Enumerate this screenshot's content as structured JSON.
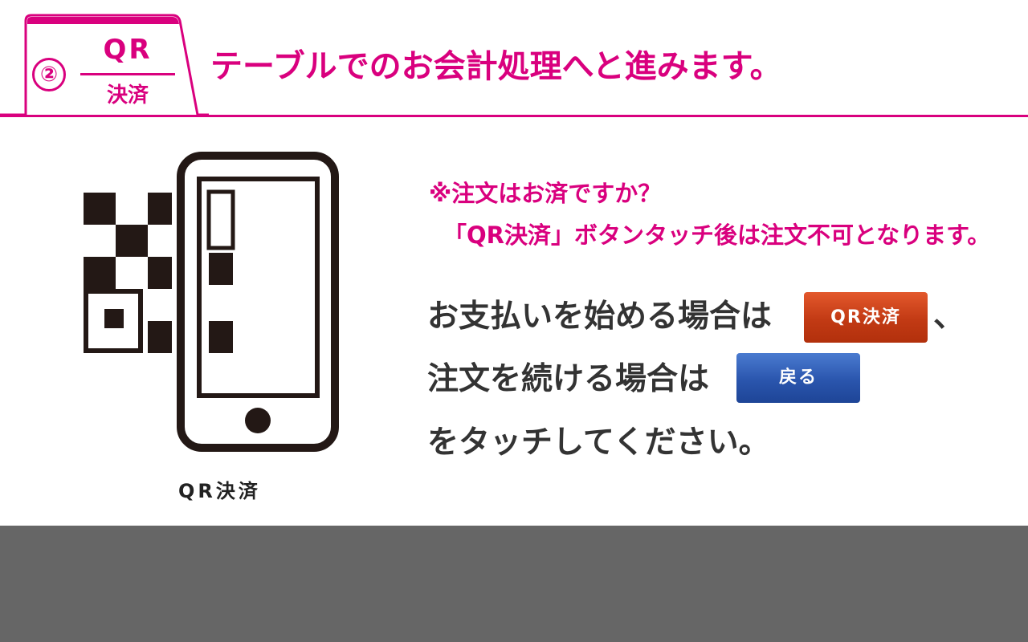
{
  "header": {
    "step_number": "②",
    "tab_title": "QR",
    "tab_subtitle": "決済",
    "title": "テーブルでのお会計処理へと進みます。"
  },
  "illustration": {
    "caption": "QR決済",
    "icon": "phone-qr-icon"
  },
  "notice": {
    "line1": "※注文はお済ですか？",
    "line2": "「QR決済」ボタンタッチ後は注文不可となります。"
  },
  "instructions": {
    "line1_prefix": "お支払いを始める場合は",
    "line1_suffix": "、",
    "line2_prefix": "注文を続ける場合は",
    "line3": "をタッチしてください。"
  },
  "buttons": {
    "qr_pay_label": "QR決済",
    "back_label": "戻る"
  },
  "colors": {
    "accent": "#d9007e",
    "qr_button": "#c8401a",
    "back_button": "#2a55ad",
    "bottom_bar": "#666666"
  }
}
